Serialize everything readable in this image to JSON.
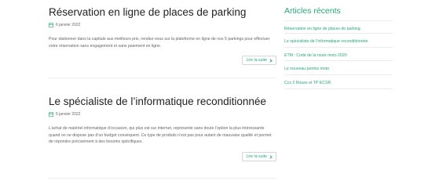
{
  "posts": [
    {
      "title": "Réservation en ligne de places de parking",
      "date": "6 janvier 2022",
      "excerpt": "Pour stationner dans la capitale aux meilleurs prix, rendez-vous sur la plateforme en ligne de nos 5 parkings pour effectuer votre réservation sans engagement et sans paiement en ligne.",
      "read_more": "Lire la suite"
    },
    {
      "title": "Le spécialiste de l’informatique reconditionnée",
      "date": "5 janvier 2022",
      "excerpt": "L’achat de matériel informatique d’occasion, qui plus est sur internet, représente sans doute l’option la plus intéressante quand on ne dispose pas d’un budget conséquent. Ce type de produits n’est pas pour autant de mauvaise qualité et permet de répondre précisément à des besoins spécifiques.",
      "read_more": "Lire la suite"
    }
  ],
  "sidebar": {
    "title": "Articles récents",
    "items": [
      "Réservation en ligne de places de parking",
      "Le spécialiste de l’informatique reconditionnée",
      "ETM : Code de la route moto 2020",
      "Le nouveau permis moto",
      "Ccs 2 Roues et TP ECSR"
    ]
  },
  "colors": {
    "accent": "#27a776",
    "text": "#222222",
    "muted": "#666666"
  },
  "icons": {
    "date": "calendar-icon",
    "read_more": "chevron-right-icon"
  }
}
